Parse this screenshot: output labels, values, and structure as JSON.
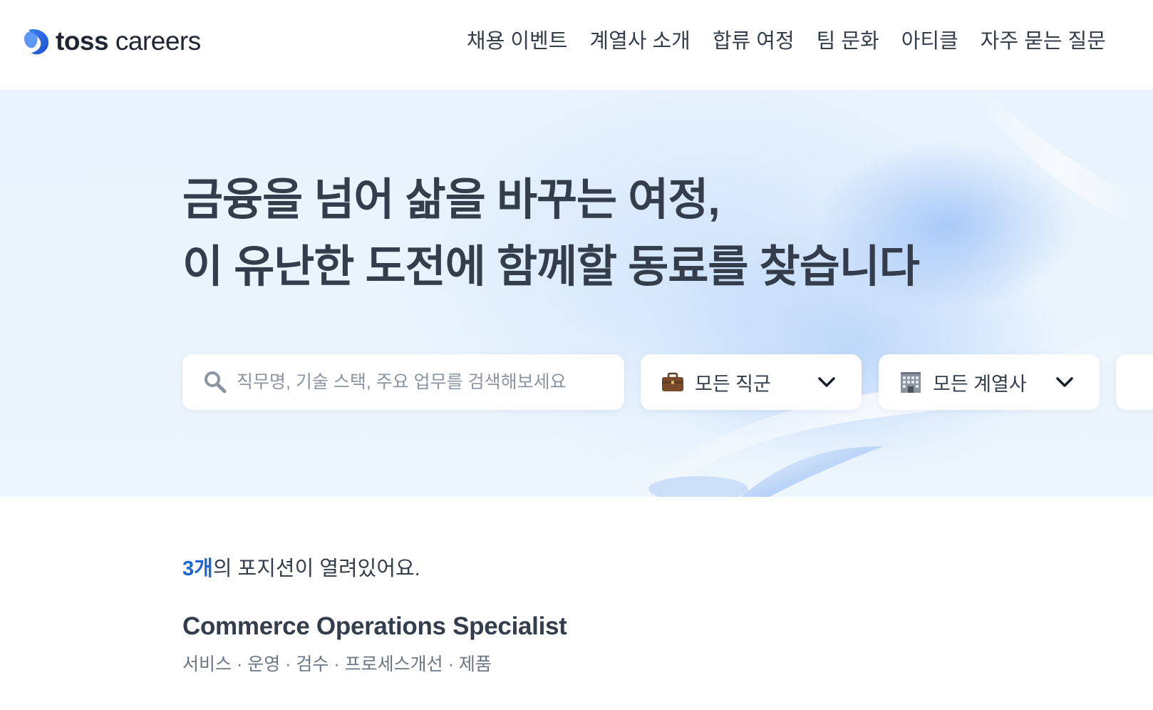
{
  "header": {
    "logo_text_bold": "toss",
    "logo_text_light": "careers",
    "nav": [
      {
        "label": "채용 이벤트"
      },
      {
        "label": "계열사 소개"
      },
      {
        "label": "합류 여정"
      },
      {
        "label": "팀 문화"
      },
      {
        "label": "아티클"
      },
      {
        "label": "자주 묻는 질문"
      }
    ]
  },
  "hero": {
    "title_line1": "금융을 넘어 삶을 바꾸는 여정,",
    "title_line2": "이 유난한 도전에 함께할 동료를 찾습니다",
    "search": {
      "placeholder": "직무명, 기술 스택, 주요 업무를 검색해보세요",
      "value": "",
      "icon": "magnifier-icon"
    },
    "job_filter": {
      "icon": "briefcase-icon",
      "selected": "모든 직군"
    },
    "company_filter": {
      "icon": "office-building-icon",
      "selected": "모든 계열사"
    }
  },
  "results": {
    "count": "3개",
    "count_suffix": "의 포지션이 열려있어요.",
    "jobs": [
      {
        "title": "Commerce Operations Specialist",
        "tags": "서비스 · 운영 · 검수 · 프로세스개선 · 제품"
      }
    ]
  },
  "colors": {
    "brand_blue": "#1b64da",
    "text_primary": "#333d4b",
    "text_secondary": "#6b7684",
    "hero_bg": "#e9f3fd"
  }
}
